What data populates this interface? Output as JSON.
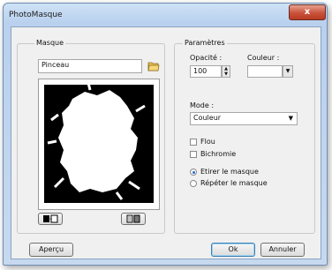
{
  "window": {
    "title": "PhotoMasque",
    "close_label": "x"
  },
  "masque": {
    "group_label": "Masque",
    "brush_value": "Pinceau",
    "folder_icon": "folder-open-icon",
    "invert_icon": "invert-icon",
    "swap_icon": "swap-icon"
  },
  "parametres": {
    "group_label": "Paramètres",
    "opacity_label": "Opacité :",
    "opacity_value": "100",
    "color_label": "Couleur :",
    "color_value": "#ffffff",
    "mode_label": "Mode :",
    "mode_value": "Couleur",
    "flou_label": "Flou",
    "flou_checked": false,
    "bichromie_label": "Bichromie",
    "bichromie_checked": false,
    "etirer_label": "Etirer le masque",
    "etirer_selected": true,
    "repeter_label": "Répéter le masque",
    "repeter_selected": false
  },
  "footer": {
    "apercu_label": "Aperçu",
    "ok_label": "Ok",
    "annuler_label": "Annuler"
  }
}
